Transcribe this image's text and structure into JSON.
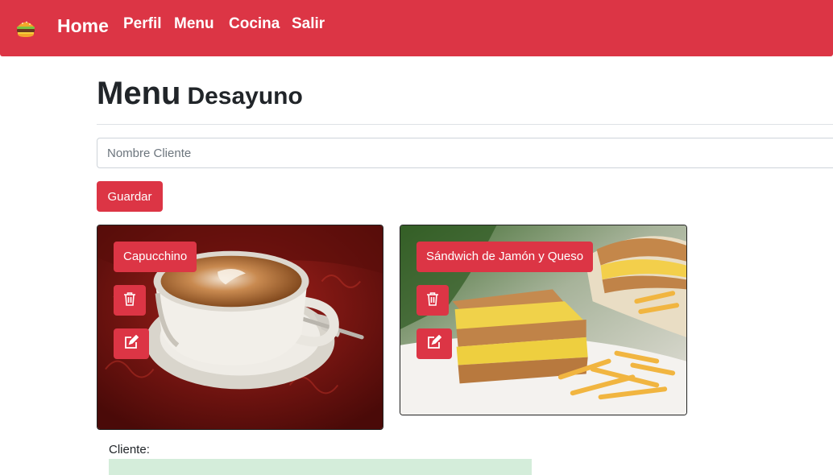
{
  "navbar": {
    "brand_icon": "burger-icon",
    "links": [
      "Home",
      "Perfil",
      "Menu",
      "Cocina",
      "Salir"
    ],
    "color": "#dc3545"
  },
  "page": {
    "title": "Menu",
    "subtitle": "Desayuno"
  },
  "form": {
    "client_placeholder": "Nombre Cliente",
    "client_value": "",
    "save_label": "Guardar"
  },
  "items": [
    {
      "name": "Capucchino",
      "image": "cappuccino-photo",
      "delete_icon": "trash-icon",
      "edit_icon": "edit-icon"
    },
    {
      "name": "Sándwich de Jamón y Queso",
      "image": "sandwich-photo",
      "delete_icon": "trash-icon",
      "edit_icon": "edit-icon"
    }
  ],
  "order": {
    "client_label": "Cliente:"
  }
}
